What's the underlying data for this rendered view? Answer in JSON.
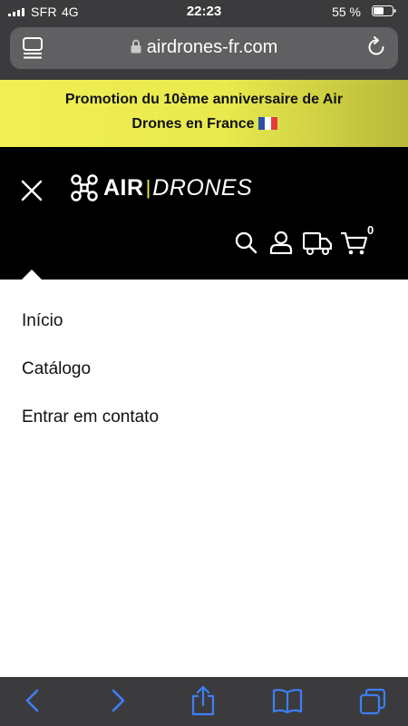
{
  "status_bar": {
    "carrier": "SFR",
    "network": "4G",
    "time": "22:23",
    "battery": "55 %",
    "battery_level": 0.55
  },
  "browser": {
    "url": "airdrones-fr.com"
  },
  "promo": {
    "line1": "Promotion du 10ème anniversaire de Air",
    "line2": "Drones en France"
  },
  "header": {
    "logo_air": "AIR",
    "logo_separator": "|",
    "logo_drones": "DRONES",
    "cart_count": "0",
    "brand_color": "#e9ea4e"
  },
  "menu": {
    "items": [
      {
        "label": "Início"
      },
      {
        "label": "Catálogo"
      },
      {
        "label": "Entrar em contato"
      }
    ]
  },
  "icons": [
    "tabs-icon",
    "lock-icon",
    "reload-icon",
    "close-icon",
    "drone-logo-icon",
    "search-icon",
    "account-icon",
    "delivery-truck-icon",
    "cart-icon",
    "back-icon",
    "forward-icon",
    "share-icon",
    "bookmarks-icon",
    "tabs-overview-icon"
  ]
}
